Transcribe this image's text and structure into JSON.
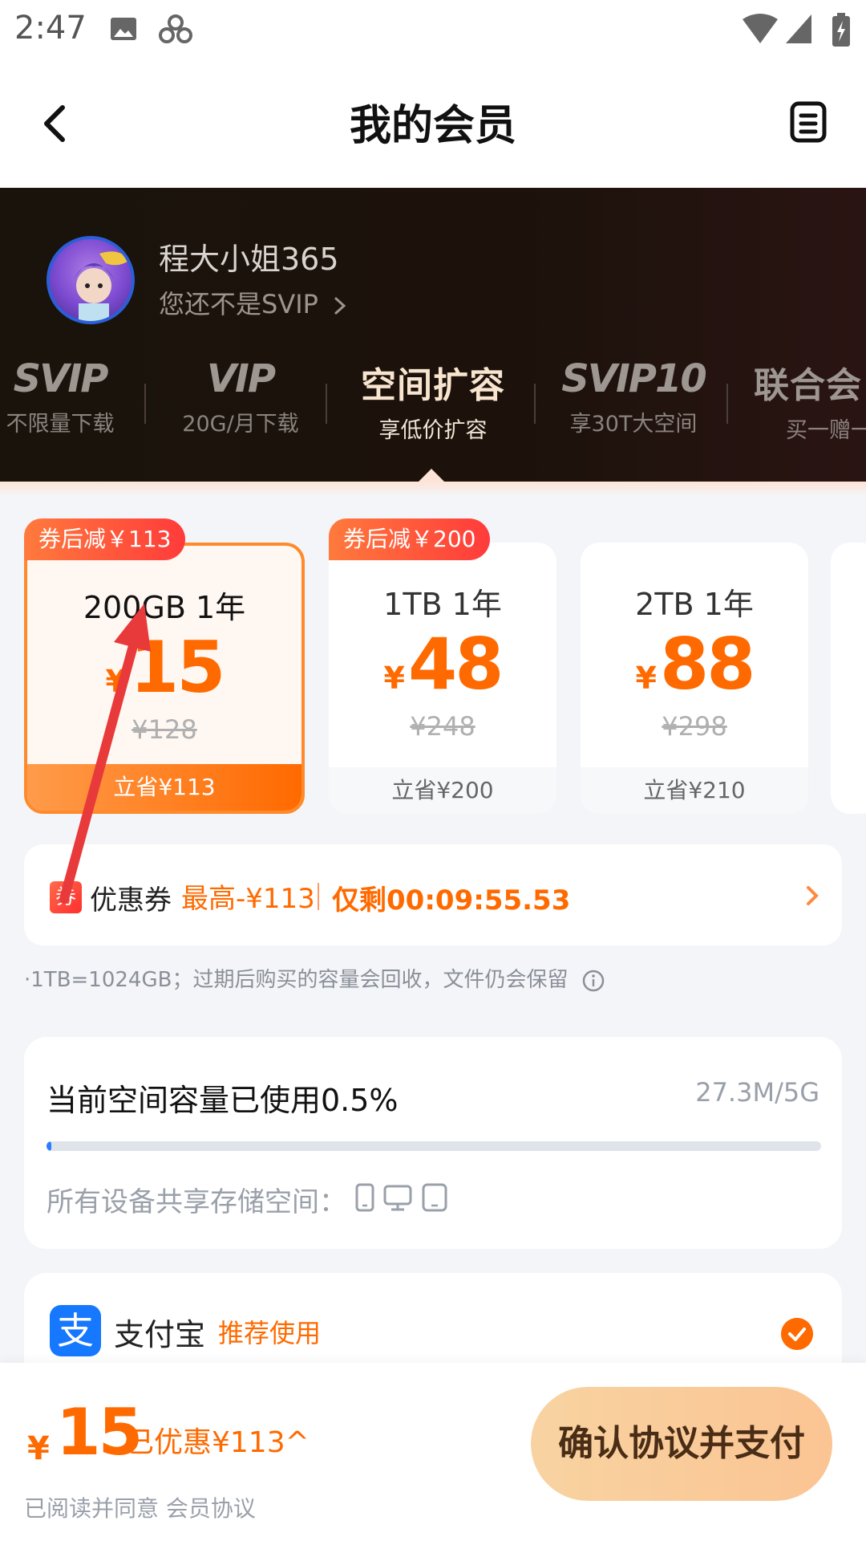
{
  "status_bar": {
    "time": "2:47",
    "icons": [
      "image-icon",
      "app-icon",
      "wifi-icon",
      "signal-icon",
      "battery-icon"
    ]
  },
  "header": {
    "title": "我的会员",
    "back_icon": "chevron-left-icon",
    "menu_icon": "order-list-icon"
  },
  "profile": {
    "username": "程大小姐365",
    "vip_status": "您还不是SVIP"
  },
  "tabs": [
    {
      "logo": "SVIP",
      "sub": "不限量下载"
    },
    {
      "logo": "VIP",
      "sub": "20G/月下载"
    },
    {
      "logo": "空间扩容",
      "sub": "享低价扩容",
      "active": true
    },
    {
      "logo": "SVIP10",
      "sub": "享30T大空间"
    },
    {
      "logo": "联合会",
      "sub": "买一赠一"
    }
  ],
  "plans": [
    {
      "tag": "券后减￥113",
      "name": "200GB 1年",
      "yen": "¥",
      "price": "15",
      "original": "¥128",
      "save": "立省¥113",
      "selected": true
    },
    {
      "tag": "券后减￥200",
      "name": "1TB 1年",
      "yen": "¥",
      "price": "48",
      "original": "¥248",
      "save": "立省¥200"
    },
    {
      "tag": "",
      "name": "2TB 1年",
      "yen": "¥",
      "price": "88",
      "original": "¥298",
      "save": "立省¥210"
    }
  ],
  "coupon": {
    "icon_char": "券",
    "label": "优惠券",
    "max": "最高-¥113",
    "timer": "仅剩00:09:55.53"
  },
  "note": "·1TB=1024GB；过期后购买的容量会回收，文件仍会保留",
  "storage": {
    "title": "当前空间容量已使用0.5%",
    "amount": "27.3M/5G",
    "used_fraction": 0.005,
    "devices_label": "所有设备共享存储空间："
  },
  "payment": {
    "logo_char": "支",
    "name": "支付宝",
    "tag": "推荐使用"
  },
  "bottom": {
    "yen": "¥",
    "total": "15",
    "discount": "已优惠¥113^",
    "agreement": "已阅读并同意 会员协议",
    "confirm": "确认协议并支付"
  },
  "colors": {
    "accent": "#ff6a00",
    "hero_bg": "#1a130c",
    "progress": "#2b7cff",
    "annotation_arrow": "#e83a3a"
  }
}
